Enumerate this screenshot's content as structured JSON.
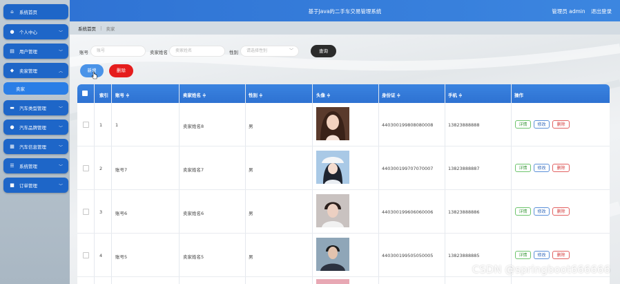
{
  "sidebar": {
    "items": [
      {
        "label": "系统首页",
        "icon": "home-icon",
        "chevron": false
      },
      {
        "label": "个人中心",
        "icon": "user-icon",
        "chevron": true
      },
      {
        "label": "用户管理",
        "icon": "document-icon",
        "chevron": true
      },
      {
        "label": "卖家管理",
        "icon": "location-icon",
        "chevron": true,
        "expanded": true
      },
      {
        "label": "汽车类型管理",
        "icon": "car-icon",
        "chevron": true
      },
      {
        "label": "汽车品牌管理",
        "icon": "user-icon",
        "chevron": true
      },
      {
        "label": "汽车信息管理",
        "icon": "grid-icon",
        "chevron": true
      },
      {
        "label": "系统管理",
        "icon": "list-icon",
        "chevron": true
      },
      {
        "label": "订单管理",
        "icon": "cart-icon",
        "chevron": true
      }
    ],
    "sub_item": "卖家"
  },
  "header": {
    "title": "基于Java的二手车交易管理系统",
    "user": "管理员 admin",
    "logout": "退出登录"
  },
  "breadcrumb": {
    "home": "系统首页",
    "separator": "⋮",
    "current": "卖家"
  },
  "search": {
    "account_label": "账号",
    "account_placeholder": "账号",
    "name_label": "卖家姓名",
    "name_placeholder": "卖家姓名",
    "gender_label": "性别",
    "gender_placeholder": "请选择性别",
    "query_button": "查询"
  },
  "actions": {
    "add": "新增",
    "delete": "删除"
  },
  "table": {
    "headers": [
      "索引",
      "账号 ≑",
      "卖家姓名 ≑",
      "性别 ≑",
      "头像 ≑",
      "身份证 ≑",
      "手机 ≑",
      "操作"
    ],
    "rows": [
      {
        "index": "1",
        "account": "1",
        "name": "卖家姓名8",
        "gender": "男",
        "id_card": "440300199808080008",
        "phone": "13823888888"
      },
      {
        "index": "2",
        "account": "账号7",
        "name": "卖家姓名7",
        "gender": "男",
        "id_card": "440300199707070007",
        "phone": "13823888887"
      },
      {
        "index": "3",
        "account": "账号6",
        "name": "卖家姓名6",
        "gender": "男",
        "id_card": "440300199606060006",
        "phone": "13823888886"
      },
      {
        "index": "4",
        "account": "账号5",
        "name": "卖家姓名5",
        "gender": "男",
        "id_card": "440300199505050005",
        "phone": "13823888885"
      }
    ],
    "op_labels": {
      "detail": "详情",
      "edit": "修改",
      "delete": "删除"
    }
  },
  "watermark": "CSDN @springboot666666",
  "colors": {
    "primary": "#2f73d4",
    "danger": "#e51d1d",
    "query": "#2b2b2b"
  }
}
